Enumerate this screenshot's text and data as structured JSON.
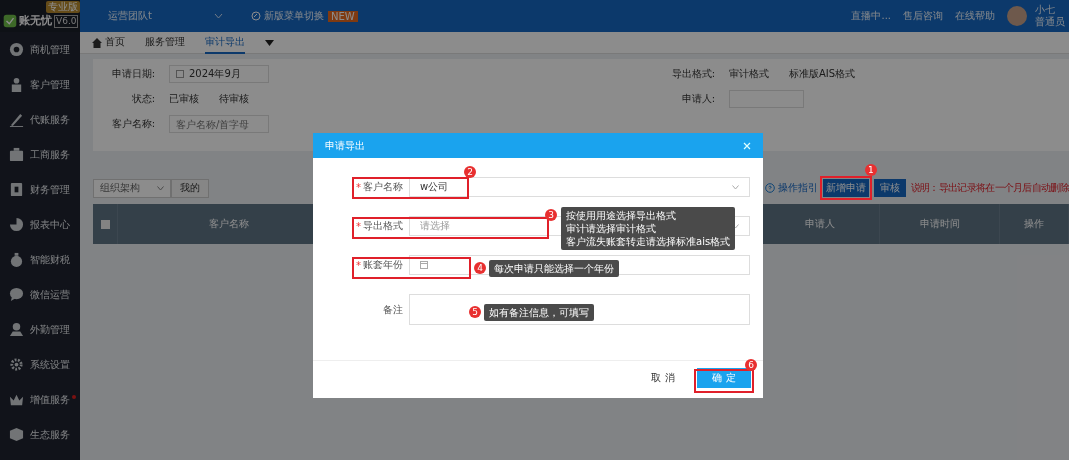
{
  "app": {
    "logo": "账无忧",
    "version": "V6.0",
    "edition": "专业版"
  },
  "sidebar": {
    "items": [
      {
        "label": "商机管理",
        "dot": false
      },
      {
        "label": "客户管理",
        "dot": false
      },
      {
        "label": "代账服务",
        "dot": false
      },
      {
        "label": "工商服务",
        "dot": false
      },
      {
        "label": "财务管理",
        "dot": false
      },
      {
        "label": "报表中心",
        "dot": false
      },
      {
        "label": "智能财税",
        "dot": false
      },
      {
        "label": "微信运营",
        "dot": false
      },
      {
        "label": "外勤管理",
        "dot": false
      },
      {
        "label": "系统设置",
        "dot": false
      },
      {
        "label": "增值服务",
        "dot": true
      },
      {
        "label": "生态服务",
        "dot": false
      }
    ]
  },
  "topbar": {
    "team": "运营团队t",
    "menu_switch": "新版菜单切换",
    "menu_switch_badge": "NEW",
    "links": [
      {
        "label": "直播中..."
      },
      {
        "label": "售后咨询"
      },
      {
        "label": "在线帮助"
      }
    ],
    "user": {
      "name": "小七",
      "role": "普通员"
    }
  },
  "tabs": [
    {
      "label": "首页",
      "selected": false
    },
    {
      "label": "服务管理",
      "selected": false
    },
    {
      "label": "审计导出",
      "selected": true
    }
  ],
  "filters": {
    "date_label": "申请日期:",
    "date_value": "2024年9月",
    "status_label": "状态:",
    "status_options": [
      "已审核",
      "待审核"
    ],
    "customer_label": "客户名称:",
    "customer_placeholder": "客户名称/首字母",
    "format_label": "导出格式:",
    "format_options": [
      "审计格式",
      "标准版AIS格式"
    ],
    "applicant_label": "申请人:"
  },
  "toolbar": {
    "org_select": "组织架构",
    "mine_button": "我的",
    "guide": "操作指引",
    "buttons": [
      "新增申请",
      "审核"
    ],
    "note": "说明：导出记录将在一个月后自动删除"
  },
  "table": {
    "select_all_checked": false,
    "columns": [
      "客户名称",
      "申请人",
      "申请时间",
      "操作"
    ]
  },
  "dialog": {
    "title": "申请导出",
    "required_mark": "*",
    "fields": [
      {
        "kind": "select",
        "label": "客户名称",
        "required": true,
        "value": "w公司"
      },
      {
        "kind": "select",
        "label": "导出格式",
        "required": true,
        "placeholder": "请选择"
      },
      {
        "kind": "date",
        "label": "账套年份",
        "required": true
      },
      {
        "kind": "textarea",
        "label": "备注",
        "required": false
      }
    ],
    "cancel": "取 消",
    "confirm": "确 定"
  },
  "annotations": [
    {
      "number": "1"
    },
    {
      "number": "2"
    },
    {
      "number": "3",
      "tooltip": [
        "按使用用途选择导出格式",
        "审计请选择审计格式",
        "客户流失账套转走请选择标准ais格式"
      ]
    },
    {
      "number": "4",
      "tooltip": [
        "每次申请只能选择一个年份"
      ]
    },
    {
      "number": "5",
      "tooltip": [
        "如有备注信息，可填写"
      ]
    },
    {
      "number": "6"
    }
  ]
}
